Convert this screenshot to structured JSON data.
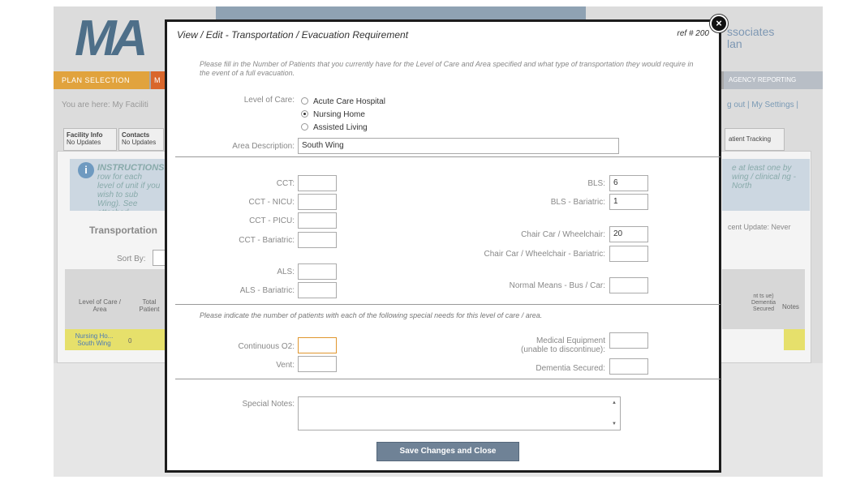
{
  "background": {
    "logo": "MA",
    "associates": [
      "ssociates",
      "lan"
    ],
    "nav_left": "PLAN SELECTION",
    "nav_left2": "M",
    "nav_right": "AGENCY REPORTING",
    "breadcrumb": "You are here: My Faciliti",
    "user_links": "g out | My Settings |",
    "tabs": [
      {
        "label": "Facility Info",
        "sub": "No Updates"
      },
      {
        "label": "Contacts",
        "sub": "No Updates"
      }
    ],
    "patient_tab": "atient Tracking",
    "instructions_title": "INSTRUCTIONS",
    "instructions_text": "row for each level of unit if you wish to sub Wing). See attached",
    "instructions_right": "e at least one by wing / clinical ng - North",
    "section_title": "Transportation",
    "recent_update": "cent Update: Never",
    "sort_by": "Sort By:",
    "table_headers": [
      "Level of Care / Area",
      "Total Patient",
      "Dementia Secured",
      "Notes"
    ],
    "table_header_partial": "nt ts ue)",
    "row": {
      "area": "Nursing Ho... South Wing",
      "total": "0"
    }
  },
  "modal": {
    "title": "View / Edit - Transportation / Evacuation Requirement",
    "ref": "ref # 200",
    "close": "×",
    "intro": "Please fill in the Number of Patients that you currently have for the Level of Care and Area specified and what type of transportation they would require in the event of a full evacuation.",
    "level_of_care_label": "Level of Care:",
    "level_options": [
      {
        "label": "Acute Care Hospital",
        "selected": false
      },
      {
        "label": "Nursing Home",
        "selected": true
      },
      {
        "label": "Assisted Living",
        "selected": false
      }
    ],
    "area_label": "Area Description:",
    "area_value": "South Wing",
    "transport_left": [
      {
        "label": "CCT:",
        "value": ""
      },
      {
        "label": "CCT - NICU:",
        "value": ""
      },
      {
        "label": "CCT - PICU:",
        "value": ""
      },
      {
        "label": "CCT - Bariatric:",
        "value": ""
      },
      {
        "label": "ALS:",
        "value": ""
      },
      {
        "label": "ALS - Bariatric:",
        "value": ""
      }
    ],
    "transport_right": [
      {
        "label": "BLS:",
        "value": "6"
      },
      {
        "label": "BLS - Bariatric:",
        "value": "1"
      },
      {
        "label": "Chair Car / Wheelchair:",
        "value": "20"
      },
      {
        "label": "Chair Car / Wheelchair - Bariatric:",
        "value": ""
      },
      {
        "label": "Normal Means - Bus / Car:",
        "value": ""
      }
    ],
    "special_needs_intro": "Please indicate the number of patients with each of the following special needs for this level of care / area.",
    "special_left": [
      {
        "label": "Continuous O2:",
        "value": ""
      },
      {
        "label": "Vent:",
        "value": ""
      }
    ],
    "special_right": [
      {
        "label": "Medical Equipment",
        "label2": "(unable to discontinue):",
        "value": ""
      },
      {
        "label": "Dementia Secured:",
        "value": ""
      }
    ],
    "special_notes_label": "Special Notes:",
    "special_notes_value": "",
    "save_button": "Save Changes and Close"
  }
}
